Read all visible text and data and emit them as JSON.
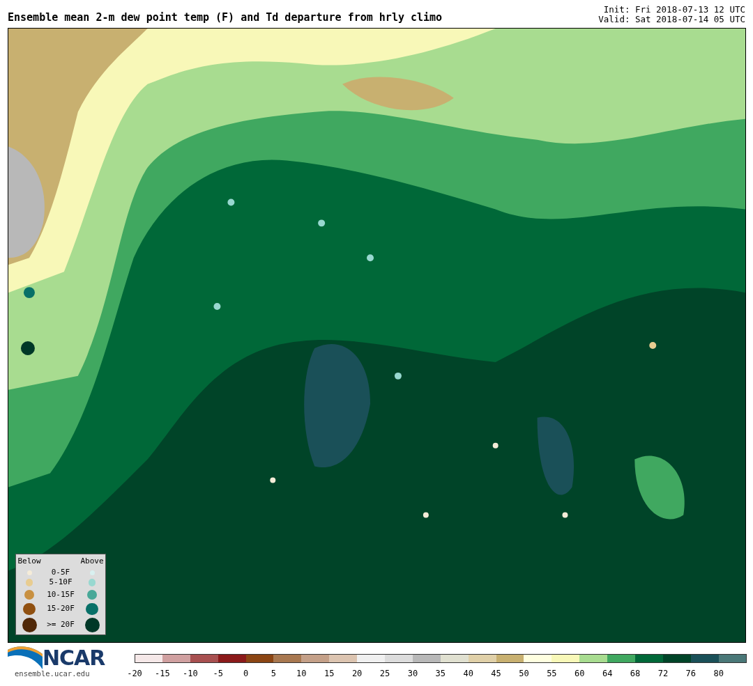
{
  "title": "Ensemble mean 2-m dew point temp (F) and Td departure from hrly climo",
  "init": "Init: Fri 2018-07-13 12 UTC",
  "valid": "Valid: Sat 2018-07-14 05 UTC",
  "legend": {
    "below_heading": "Below",
    "above_heading": "Above",
    "rows": [
      {
        "label": "0-5F",
        "below": {
          "color": "#f5ecd8"
        },
        "above": {
          "color": "#d8f0f0"
        }
      },
      {
        "label": "5-10F",
        "below": {
          "color": "#e8cc90"
        },
        "above": {
          "color": "#98d8d0"
        }
      },
      {
        "label": "10-15F",
        "below": {
          "color": "#c89040"
        },
        "above": {
          "color": "#48a898"
        }
      },
      {
        "label": "15-20F",
        "below": {
          "color": "#905010"
        },
        "above": {
          "color": "#087068"
        }
      },
      {
        "label": ">= 20F",
        "below": {
          "color": "#502808"
        },
        "above": {
          "color": "#003828"
        }
      }
    ]
  },
  "logo": {
    "name": "NCAR",
    "url": "ensemble.ucar.edu"
  },
  "colorbar": {
    "segments": [
      {
        "label": "-20",
        "color": "#f5e8e8"
      },
      {
        "label": "-15",
        "color": "#d0a0a0"
      },
      {
        "label": "-10",
        "color": "#a85050"
      },
      {
        "label": "-5",
        "color": "#8b1a1a"
      },
      {
        "label": "0",
        "color": "#8b4513"
      },
      {
        "label": "5",
        "color": "#a87850"
      },
      {
        "label": "10",
        "color": "#c4a088"
      },
      {
        "label": "15",
        "color": "#dcc4b0"
      },
      {
        "label": "20",
        "color": "#f0f0f0"
      },
      {
        "label": "25",
        "color": "#dcdcdc"
      },
      {
        "label": "30",
        "color": "#b8b8b8"
      },
      {
        "label": "35",
        "color": "#e0e0d0"
      },
      {
        "label": "40",
        "color": "#e0d0a8"
      },
      {
        "label": "45",
        "color": "#c8b070"
      },
      {
        "label": "50",
        "color": "#ffffe0"
      },
      {
        "label": "55",
        "color": "#f8f8b8"
      },
      {
        "label": "60",
        "color": "#a8dc90"
      },
      {
        "label": "64",
        "color": "#40a860"
      },
      {
        "label": "68",
        "color": "#006838"
      },
      {
        "label": "72",
        "color": "#004428"
      },
      {
        "label": "76",
        "color": "#1a5058"
      },
      {
        "label": "80",
        "color": "#4a7878"
      }
    ]
  }
}
